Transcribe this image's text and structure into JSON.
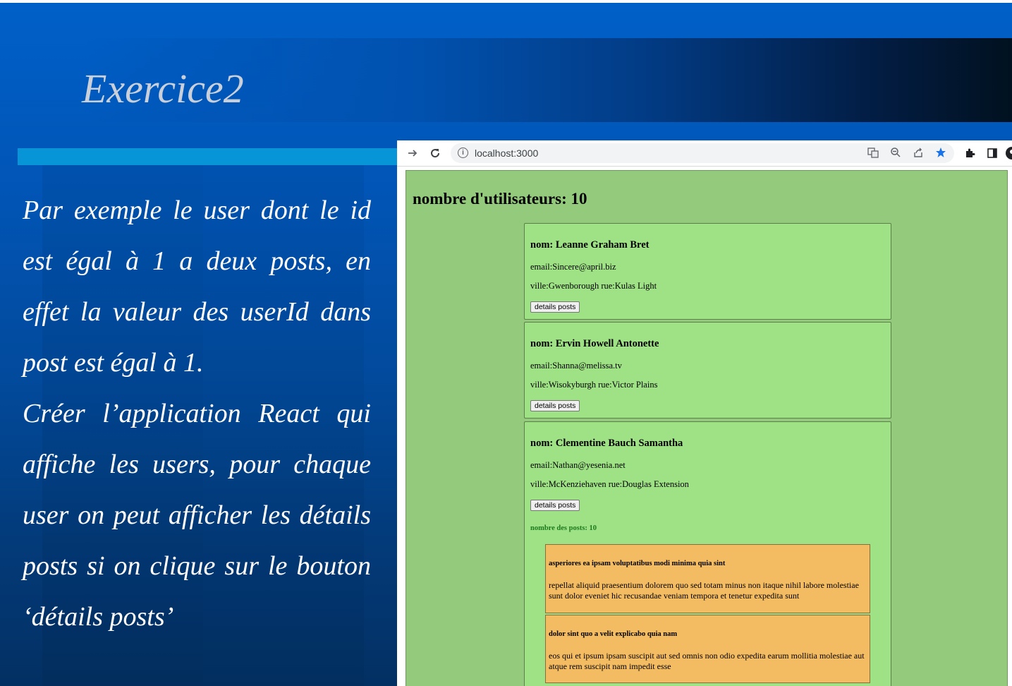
{
  "slide": {
    "title": "Exercice2",
    "paragraph_1": "Par exemple le user dont le id est égal à 1 a deux posts, en effet la valeur des userId dans post est égal à 1.",
    "paragraph_2": "Créer l’application React qui affiche les users, pour chaque user on peut afficher les détails posts si on clique sur le bouton ‘détails posts’"
  },
  "browser": {
    "url": "localhost:3000",
    "toolbar_icons": [
      "forward-arrow-icon",
      "reload-icon",
      "info-icon",
      "translate-icon",
      "zoom-icon",
      "share-icon",
      "star-icon",
      "extensions-icon",
      "side-panel-icon",
      "profile-avatar"
    ]
  },
  "app": {
    "user_count_label": "nombre d'utilisateurs: 10",
    "users": [
      {
        "name": "nom: Leanne Graham Bret",
        "email": "email:Sincere@april.biz",
        "address": "ville:Gwenborough rue:Kulas Light",
        "button": "details posts"
      },
      {
        "name": "nom: Ervin Howell Antonette",
        "email": "email:Shanna@melissa.tv",
        "address": "ville:Wisokyburgh rue:Victor Plains",
        "button": "details posts"
      },
      {
        "name": "nom: Clementine Bauch Samantha",
        "email": "email:Nathan@yesenia.net",
        "address": "ville:McKenziehaven rue:Douglas Extension",
        "button": "details posts",
        "posts_count": "nombre des posts: 10",
        "posts": [
          {
            "title": "asperiores ea ipsam voluptatibus modi minima quia sint",
            "body": "repellat aliquid praesentium dolorem quo sed totam minus non itaque nihil labore molestiae sunt dolor eveniet hic recusandae veniam tempora et tenetur expedita sunt"
          },
          {
            "title": "dolor sint quo a velit explicabo quia nam",
            "body": "eos qui et ipsum ipsam suscipit aut sed omnis non odio expedita earum mollitia molestiae aut atque rem suscipit nam impedit esse"
          }
        ]
      }
    ]
  },
  "colors": {
    "slide_blue": "#0156b8",
    "accent_bar": "#0795d8",
    "app_background": "#94ca7c",
    "card_background": "#9fe286",
    "post_background": "#f3bb62",
    "posts_count_text": "#1c7a1c",
    "bookmark_star": "#1a73e8"
  }
}
